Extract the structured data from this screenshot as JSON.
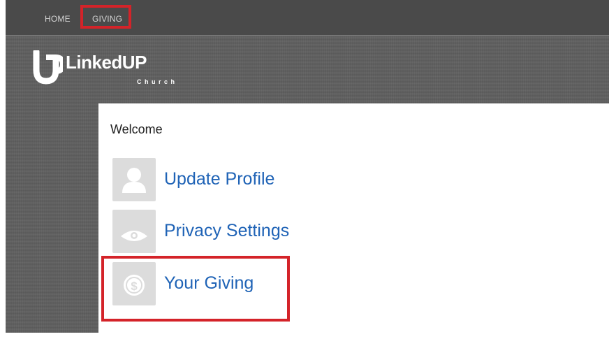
{
  "nav": {
    "items": [
      {
        "label": "HOME"
      },
      {
        "label": "GIVING"
      }
    ]
  },
  "logo": {
    "name": "LinkedUP",
    "sub": "Church"
  },
  "content": {
    "welcome": "Welcome",
    "menu": [
      {
        "label": "Update Profile",
        "icon": "person-icon"
      },
      {
        "label": "Privacy Settings",
        "icon": "eye-icon"
      },
      {
        "label": "Your Giving",
        "icon": "dollar-coin-icon"
      }
    ]
  },
  "colors": {
    "link": "#1f63b6",
    "highlight": "#d42329",
    "icon_bg": "#dcdcdc",
    "frame_bg": "#5f5f5f"
  }
}
